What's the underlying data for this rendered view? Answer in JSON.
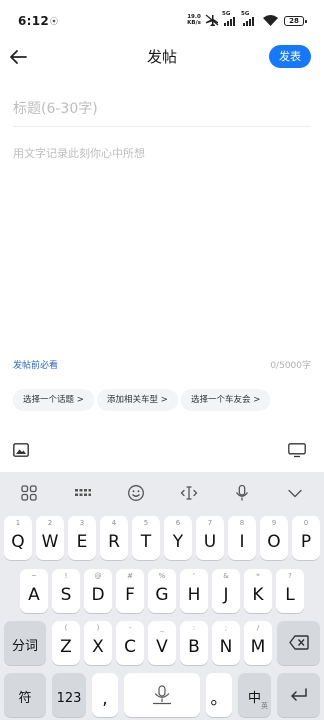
{
  "status_bar": {
    "time": "6:12",
    "network_speed_value": "19.0",
    "network_speed_unit": "KB/s",
    "sim1_label": "5G",
    "sim2_label": "5G",
    "battery": "28"
  },
  "header": {
    "title": "发帖",
    "publish_label": "发表"
  },
  "editor": {
    "title_placeholder": "标题(6-30字)",
    "body_placeholder": "用文字记录此刻你心中所想",
    "rules_link": "发帖前必看",
    "char_counter": "0/5000字"
  },
  "chips": [
    "选择一个话题 >",
    "添加相关车型 >",
    "选择一个车友会 >"
  ],
  "keyboard": {
    "row1": [
      {
        "main": "Q",
        "hint": "1"
      },
      {
        "main": "W",
        "hint": "2"
      },
      {
        "main": "E",
        "hint": "3"
      },
      {
        "main": "R",
        "hint": "4"
      },
      {
        "main": "T",
        "hint": "5"
      },
      {
        "main": "Y",
        "hint": "6"
      },
      {
        "main": "U",
        "hint": "7"
      },
      {
        "main": "I",
        "hint": "8"
      },
      {
        "main": "O",
        "hint": "9"
      },
      {
        "main": "P",
        "hint": "0"
      }
    ],
    "row2": [
      {
        "main": "A",
        "hint": "~"
      },
      {
        "main": "S",
        "hint": "!"
      },
      {
        "main": "D",
        "hint": "@"
      },
      {
        "main": "F",
        "hint": "#"
      },
      {
        "main": "G",
        "hint": "%"
      },
      {
        "main": "H",
        "hint": "'"
      },
      {
        "main": "J",
        "hint": "&"
      },
      {
        "main": "K",
        "hint": "*"
      },
      {
        "main": "L",
        "hint": "?"
      }
    ],
    "row3": [
      {
        "main": "Z",
        "hint": "("
      },
      {
        "main": "X",
        "hint": ")"
      },
      {
        "main": "C",
        "hint": "-"
      },
      {
        "main": "V",
        "hint": "_"
      },
      {
        "main": "B",
        "hint": ":"
      },
      {
        "main": "N",
        "hint": ";"
      },
      {
        "main": "M",
        "hint": "/"
      }
    ],
    "fenci": "分词",
    "symbols": "符",
    "numbers": "123",
    "comma": ",",
    "period": "。",
    "lang": "中",
    "lang_sub": "英"
  }
}
